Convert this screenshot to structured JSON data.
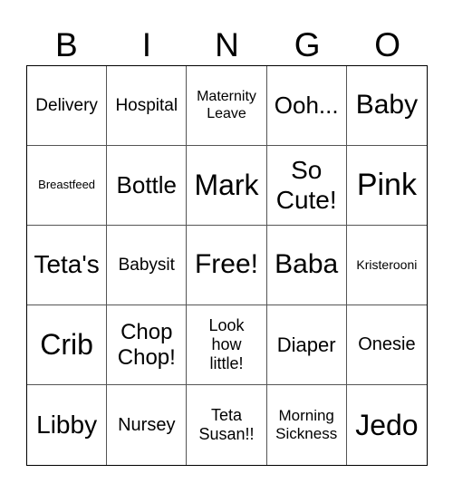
{
  "header": {
    "letters": [
      "B",
      "I",
      "N",
      "G",
      "O"
    ]
  },
  "board": {
    "cells": [
      "Delivery",
      "Hospital",
      "Maternity\nLeave",
      "Ooh...",
      "Baby",
      "Breastfeed",
      "Bottle",
      "Mark",
      "So\nCute!",
      "Pink",
      "Teta's",
      "Babysit",
      "Free!",
      "Baba",
      "Kristerooni",
      "Crib",
      "Chop\nChop!",
      "Look\nhow\nlittle!",
      "Diaper",
      "Onesie",
      "Libby",
      "Nursey",
      "Teta\nSusan!!",
      "Morning\nSickness",
      "Jedo"
    ]
  }
}
